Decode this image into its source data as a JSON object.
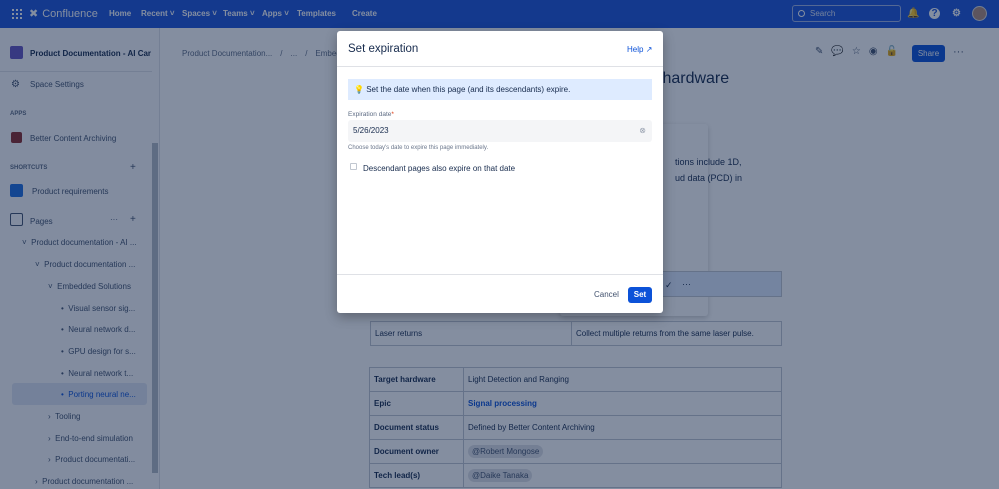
{
  "nav": {
    "app": "Confluence",
    "items": [
      "Home",
      "Recent",
      "Spaces",
      "Teams",
      "Apps",
      "Templates"
    ],
    "create": "Create",
    "search_placeholder": "Search"
  },
  "sidebar": {
    "space": "Product Documentation - AI Car",
    "space_settings": "Space Settings",
    "apps_heading": "APPS",
    "app_item": "Better Content Archiving",
    "shortcuts_heading": "SHORTCUTS",
    "shortcut": "Product requirements",
    "pages": "Pages",
    "tree": [
      "Product documentation - AI ...",
      "Product documentation ...",
      "Embedded Solutions",
      "Visual sensor sig...",
      "Neural network d...",
      "GPU design for s...",
      "Neural network t...",
      "Porting neural ne...",
      "Tooling",
      "End-to-end simulation",
      "Product documentati...",
      "Product documentation ..."
    ]
  },
  "breadcrumb": [
    "Product Documentation...",
    "/",
    "...",
    "/",
    "Embedded"
  ],
  "page": {
    "title_fragment": "c hardware",
    "text1": "tions include 1D,",
    "text2": "ud data (PCD) in",
    "share": "Share",
    "table1": [
      [
        "Laser returns",
        "Collect multiple returns from the same laser pulse."
      ]
    ],
    "table2": [
      [
        "Target hardware",
        "Light Detection and Ranging"
      ],
      [
        "Epic",
        "Signal processing"
      ],
      [
        "Document status",
        "Defined by Better Content Archiving"
      ],
      [
        "Document owner",
        "@Robert Mongose"
      ],
      [
        "Tech lead(s)",
        "@Daike Tanaka"
      ]
    ]
  },
  "modal": {
    "title": "Set expiration",
    "help": "Help",
    "info": "Set the date when this page (and its descendants) expire.",
    "field_label": "Expiration date",
    "required": "*",
    "date_value": "5/26/2023",
    "hint": "Choose today's date to expire this page immediately.",
    "checkbox_label": "Descendant pages also expire on that date",
    "cancel": "Cancel",
    "set": "Set"
  },
  "colors": {
    "nav": "#1f55d8",
    "primary": "#0c52d8",
    "info_bg": "#deebff"
  }
}
